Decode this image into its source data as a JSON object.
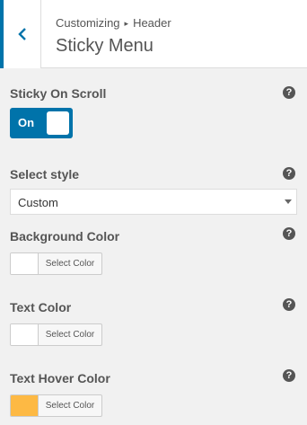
{
  "header": {
    "breadcrumb_parent": "Customizing",
    "breadcrumb_separator": "▸",
    "breadcrumb_section": "Header",
    "title": "Sticky Menu"
  },
  "controls": {
    "sticky_on_scroll": {
      "label": "Sticky On Scroll",
      "toggle_text": "On",
      "state": true
    },
    "select_style": {
      "label": "Select style",
      "value": "Custom"
    },
    "background_color": {
      "label": "Background Color",
      "button_label": "Select Color",
      "color": "#ffffff"
    },
    "text_color": {
      "label": "Text Color",
      "button_label": "Select Color",
      "color": "#ffffff"
    },
    "text_hover_color": {
      "label": "Text Hover Color",
      "button_label": "Select Color",
      "color": "#fdb944"
    }
  },
  "colors": {
    "accent": "#0073aa",
    "background": "#f1f1f1"
  },
  "help_icon": "?"
}
